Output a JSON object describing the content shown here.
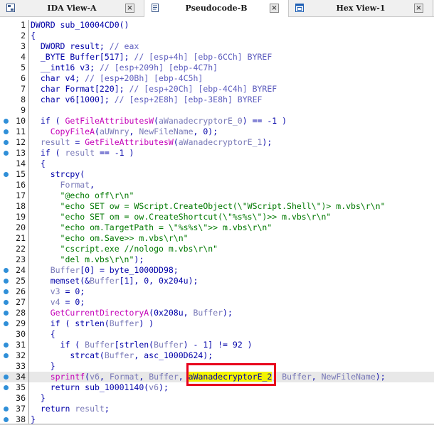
{
  "tabs": [
    {
      "label": "IDA View-A",
      "active": false,
      "close": "×"
    },
    {
      "label": "Pseudocode-B",
      "active": true,
      "close": "×"
    },
    {
      "label": "Hex View-1",
      "active": false,
      "close": "×"
    }
  ],
  "colors": {
    "keyword": "#0000a8",
    "function": "#c400b8",
    "string": "#007800",
    "variable": "#7a7ab8",
    "comment": "#5f5fbf",
    "highlight": "#f3f300",
    "annotation_box": "#e8001c",
    "breakpoint_dot": "#2f8fd8"
  },
  "current_line": 34,
  "lines": [
    {
      "n": "1",
      "dot": false,
      "code": [
        [
          "k",
          "DWORD sub_10004CD0()"
        ]
      ]
    },
    {
      "n": "2",
      "dot": false,
      "code": [
        [
          "k",
          "{"
        ]
      ]
    },
    {
      "n": "3",
      "dot": false,
      "code": [
        [
          "k",
          "  DWORD result; "
        ],
        [
          "c",
          "// eax"
        ]
      ]
    },
    {
      "n": "4",
      "dot": false,
      "code": [
        [
          "k",
          "  _BYTE Buffer[517]; "
        ],
        [
          "c",
          "// [esp+4h] [ebp-6CCh] BYREF"
        ]
      ]
    },
    {
      "n": "5",
      "dot": false,
      "code": [
        [
          "k",
          "  __int16 v3; "
        ],
        [
          "c",
          "// [esp+209h] [ebp-4C7h]"
        ]
      ]
    },
    {
      "n": "6",
      "dot": false,
      "code": [
        [
          "k",
          "  char v4; "
        ],
        [
          "c",
          "// [esp+20Bh] [ebp-4C5h]"
        ]
      ]
    },
    {
      "n": "7",
      "dot": false,
      "code": [
        [
          "k",
          "  char Format[220]; "
        ],
        [
          "c",
          "// [esp+20Ch] [ebp-4C4h] BYREF"
        ]
      ]
    },
    {
      "n": "8",
      "dot": false,
      "code": [
        [
          "k",
          "  char v6[1000]; "
        ],
        [
          "c",
          "// [esp+2E8h] [ebp-3E8h] BYREF"
        ]
      ]
    },
    {
      "n": "9",
      "dot": false,
      "code": [
        [
          "k",
          ""
        ]
      ]
    },
    {
      "n": "10",
      "dot": true,
      "code": [
        [
          "k",
          "  if ( "
        ],
        [
          "f",
          "GetFileAttributesW"
        ],
        [
          "k",
          "("
        ],
        [
          "v",
          "aWanadecryptorE_0"
        ],
        [
          "k",
          ") == -1 )"
        ]
      ]
    },
    {
      "n": "11",
      "dot": true,
      "code": [
        [
          "k",
          "    "
        ],
        [
          "f",
          "CopyFileA"
        ],
        [
          "k",
          "("
        ],
        [
          "v",
          "aUWnry"
        ],
        [
          "k",
          ", "
        ],
        [
          "v",
          "NewFileName"
        ],
        [
          "k",
          ", 0);"
        ]
      ]
    },
    {
      "n": "12",
      "dot": true,
      "code": [
        [
          "k",
          "  "
        ],
        [
          "v",
          "result"
        ],
        [
          "k",
          " = "
        ],
        [
          "f",
          "GetFileAttributesW"
        ],
        [
          "k",
          "("
        ],
        [
          "v",
          "aWanadecryptorE_1"
        ],
        [
          "k",
          ");"
        ]
      ]
    },
    {
      "n": "13",
      "dot": true,
      "code": [
        [
          "k",
          "  if ( "
        ],
        [
          "v",
          "result"
        ],
        [
          "k",
          " == -1 )"
        ]
      ]
    },
    {
      "n": "14",
      "dot": false,
      "code": [
        [
          "k",
          "  {"
        ]
      ]
    },
    {
      "n": "15",
      "dot": true,
      "code": [
        [
          "k",
          "    strcpy("
        ]
      ]
    },
    {
      "n": "16",
      "dot": false,
      "code": [
        [
          "k",
          "      "
        ],
        [
          "v",
          "Format"
        ],
        [
          "k",
          ","
        ]
      ]
    },
    {
      "n": "17",
      "dot": false,
      "code": [
        [
          "k",
          "      "
        ],
        [
          "s",
          "\"@echo off\\r\\n\""
        ]
      ]
    },
    {
      "n": "18",
      "dot": false,
      "code": [
        [
          "k",
          "      "
        ],
        [
          "s",
          "\"echo SET ow = WScript.CreateObject(\\\"WScript.Shell\\\")> m.vbs\\r\\n\""
        ]
      ]
    },
    {
      "n": "19",
      "dot": false,
      "code": [
        [
          "k",
          "      "
        ],
        [
          "s",
          "\"echo SET om = ow.CreateShortcut(\\\"%s%s\\\")>> m.vbs\\r\\n\""
        ]
      ]
    },
    {
      "n": "20",
      "dot": false,
      "code": [
        [
          "k",
          "      "
        ],
        [
          "s",
          "\"echo om.TargetPath = \\\"%s%s\\\">> m.vbs\\r\\n\""
        ]
      ]
    },
    {
      "n": "21",
      "dot": false,
      "code": [
        [
          "k",
          "      "
        ],
        [
          "s",
          "\"echo om.Save>> m.vbs\\r\\n\""
        ]
      ]
    },
    {
      "n": "22",
      "dot": false,
      "code": [
        [
          "k",
          "      "
        ],
        [
          "s",
          "\"cscript.exe //nologo m.vbs\\r\\n\""
        ]
      ]
    },
    {
      "n": "23",
      "dot": false,
      "code": [
        [
          "k",
          "      "
        ],
        [
          "s",
          "\"del m.vbs\\r\\n\""
        ],
        [
          "k",
          ");"
        ]
      ]
    },
    {
      "n": "24",
      "dot": true,
      "code": [
        [
          "k",
          "    "
        ],
        [
          "v",
          "Buffer"
        ],
        [
          "k",
          "[0] = byte_1000DD98;"
        ]
      ]
    },
    {
      "n": "25",
      "dot": true,
      "code": [
        [
          "k",
          "    memset(&"
        ],
        [
          "v",
          "Buffer"
        ],
        [
          "k",
          "[1], 0, 0x204u);"
        ]
      ]
    },
    {
      "n": "26",
      "dot": true,
      "code": [
        [
          "k",
          "    "
        ],
        [
          "v",
          "v3"
        ],
        [
          "k",
          " = 0;"
        ]
      ]
    },
    {
      "n": "27",
      "dot": true,
      "code": [
        [
          "k",
          "    "
        ],
        [
          "v",
          "v4"
        ],
        [
          "k",
          " = 0;"
        ]
      ]
    },
    {
      "n": "28",
      "dot": true,
      "code": [
        [
          "k",
          "    "
        ],
        [
          "f",
          "GetCurrentDirectoryA"
        ],
        [
          "k",
          "(0x208u, "
        ],
        [
          "v",
          "Buffer"
        ],
        [
          "k",
          ");"
        ]
      ]
    },
    {
      "n": "29",
      "dot": true,
      "code": [
        [
          "k",
          "    if ( strlen("
        ],
        [
          "v",
          "Buffer"
        ],
        [
          "k",
          ") )"
        ]
      ]
    },
    {
      "n": "30",
      "dot": false,
      "code": [
        [
          "k",
          "    {"
        ]
      ]
    },
    {
      "n": "31",
      "dot": true,
      "code": [
        [
          "k",
          "      if ( "
        ],
        [
          "v",
          "Buffer"
        ],
        [
          "k",
          "[strlen("
        ],
        [
          "v",
          "Buffer"
        ],
        [
          "k",
          ") - 1] != 92 )"
        ]
      ]
    },
    {
      "n": "32",
      "dot": true,
      "code": [
        [
          "k",
          "        strcat("
        ],
        [
          "v",
          "Buffer"
        ],
        [
          "k",
          ", asc_1000D624);"
        ]
      ]
    },
    {
      "n": "33",
      "dot": false,
      "code": [
        [
          "k",
          "    }"
        ]
      ]
    },
    {
      "n": "34",
      "dot": true,
      "code": [
        [
          "k",
          "    "
        ],
        [
          "f",
          "sprintf"
        ],
        [
          "k",
          "("
        ],
        [
          "v",
          "v6"
        ],
        [
          "k",
          ", "
        ],
        [
          "v",
          "Format"
        ],
        [
          "k",
          ", "
        ],
        [
          "v",
          "Buffer"
        ],
        [
          "k",
          ", "
        ],
        [
          "caret",
          ""
        ],
        [
          "h",
          "aWanadecryptorE_2"
        ],
        [
          "k",
          ", "
        ],
        [
          "v",
          "Buffer"
        ],
        [
          "k",
          ", "
        ],
        [
          "v",
          "NewFileName"
        ],
        [
          "k",
          ");"
        ]
      ]
    },
    {
      "n": "35",
      "dot": true,
      "code": [
        [
          "k",
          "    return sub_10001140("
        ],
        [
          "v",
          "v6"
        ],
        [
          "k",
          ");"
        ]
      ]
    },
    {
      "n": "36",
      "dot": false,
      "code": [
        [
          "k",
          "  }"
        ]
      ]
    },
    {
      "n": "37",
      "dot": true,
      "code": [
        [
          "k",
          "  return "
        ],
        [
          "v",
          "result"
        ],
        [
          "k",
          ";"
        ]
      ]
    },
    {
      "n": "38",
      "dot": true,
      "code": [
        [
          "k",
          "}"
        ]
      ]
    }
  ]
}
